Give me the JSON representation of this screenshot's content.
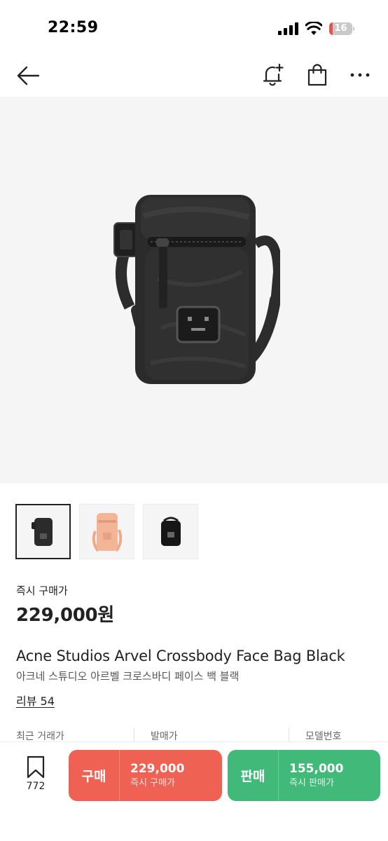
{
  "status_bar": {
    "time": "22:59",
    "battery": "16",
    "battery_level": 0.16,
    "battery_color": "#e6534f"
  },
  "nav": {
    "icons": [
      "back-arrow-icon",
      "bell-plus-icon",
      "shopping-bag-icon",
      "more-icon"
    ]
  },
  "product": {
    "thumbnails": [
      {
        "name": "black",
        "selected": true
      },
      {
        "name": "pink",
        "selected": false
      },
      {
        "name": "black-front",
        "selected": false
      }
    ],
    "price_label": "즉시 구매가",
    "price": "229,000원",
    "name_en": "Acne Studios Arvel Crossbody Face Bag Black",
    "name_ko": "아크네 스튜디오 아르벨 크로스바디 페이스 백 블랙",
    "review": "리뷰 54"
  },
  "info_row": {
    "recent": "최근 거래가",
    "release": "발매가",
    "model": "모델번호"
  },
  "bottom_bar": {
    "bookmark_count": "772",
    "buy": {
      "title": "구매",
      "price": "229,000",
      "sub": "즉시 구매가",
      "color": "#ef6253"
    },
    "sell": {
      "title": "판매",
      "price": "155,000",
      "sub": "즉시 판매가",
      "color": "#41b979"
    }
  }
}
